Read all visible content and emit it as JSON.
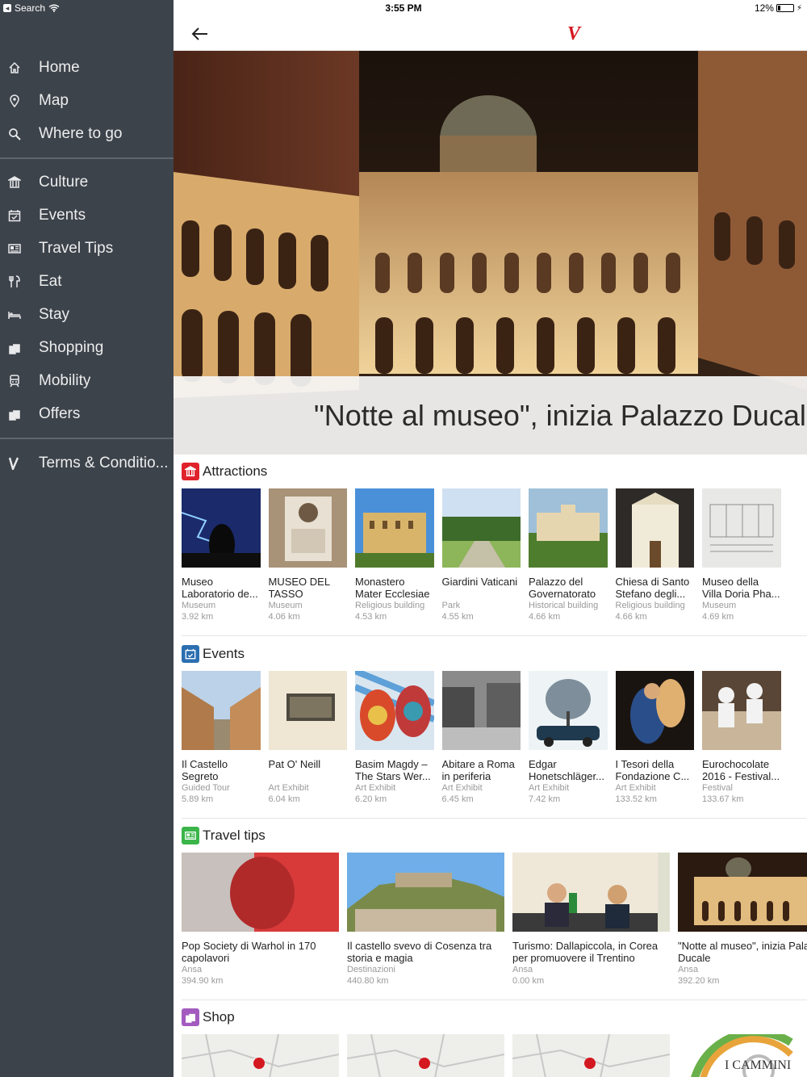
{
  "status_bar": {
    "back_label": "Search",
    "time": "3:55 PM",
    "battery": "12%"
  },
  "sidebar": {
    "main": [
      {
        "label": "Home",
        "icon": "home-icon"
      },
      {
        "label": "Map",
        "icon": "map-pin-icon"
      },
      {
        "label": "Where to go",
        "icon": "search-icon"
      }
    ],
    "categories": [
      {
        "label": "Culture",
        "icon": "museum-icon"
      },
      {
        "label": "Events",
        "icon": "calendar-icon"
      },
      {
        "label": "Travel Tips",
        "icon": "newspaper-icon"
      },
      {
        "label": "Eat",
        "icon": "restaurant-icon"
      },
      {
        "label": "Stay",
        "icon": "bed-icon"
      },
      {
        "label": "Shopping",
        "icon": "shopping-bag-icon"
      },
      {
        "label": "Mobility",
        "icon": "train-icon"
      },
      {
        "label": "Offers",
        "icon": "offers-bag-icon"
      }
    ],
    "footer": [
      {
        "label": "Terms & Conditio...",
        "icon": "brand-v-icon"
      }
    ]
  },
  "header": {
    "logo": "V"
  },
  "hero": {
    "caption": "\"Notte al museo\", inizia Palazzo Ducale"
  },
  "sections": {
    "attractions": {
      "title": "Attractions",
      "color": "#e0232b",
      "items": [
        {
          "title": "Museo Laboratorio de...",
          "category": "Museum",
          "distance": "3.92 km"
        },
        {
          "title": "MUSEO DEL TASSO",
          "category": "Museum",
          "distance": "4.06 km"
        },
        {
          "title": "Monastero Mater Ecclesiae",
          "category": "Religious building",
          "distance": "4.53 km"
        },
        {
          "title": "Giardini Vaticani",
          "category": "Park",
          "distance": "4.55 km"
        },
        {
          "title": "Palazzo del Governatorato",
          "category": "Historical building",
          "distance": "4.66 km"
        },
        {
          "title": "Chiesa di Santo Stefano degli...",
          "category": "Religious building",
          "distance": "4.66 km"
        },
        {
          "title": "Museo della Villa Doria Pha...",
          "category": "Museum",
          "distance": "4.69 km"
        }
      ]
    },
    "events": {
      "title": "Events",
      "color": "#2c6fb0",
      "items": [
        {
          "title": "Il Castello Segreto",
          "category": "Guided Tour",
          "distance": "5.89 km"
        },
        {
          "title": "Pat O' Neill",
          "category": "Art Exhibit",
          "distance": "6.04 km"
        },
        {
          "title": "Basim Magdy – The Stars Wer...",
          "category": "Art Exhibit",
          "distance": "6.20 km"
        },
        {
          "title": "Abitare a Roma in periferia",
          "category": "Art Exhibit",
          "distance": "6.45 km"
        },
        {
          "title": "Edgar Honetschläger...",
          "category": "Art Exhibit",
          "distance": "7.42 km"
        },
        {
          "title": "I Tesori della Fondazione C...",
          "category": "Art Exhibit",
          "distance": "133.52 km"
        },
        {
          "title": "Eurochocolate 2016 - Festival...",
          "category": "Festival",
          "distance": "133.67 km"
        }
      ]
    },
    "travel_tips": {
      "title": "Travel tips",
      "color": "#3bb54a",
      "items": [
        {
          "title": "Pop Society di Warhol in 170 capolavori",
          "category": "Ansa",
          "distance": "394.90 km"
        },
        {
          "title": "Il castello svevo di Cosenza tra storia e magia",
          "category": "Destinazioni",
          "distance": "440.80 km"
        },
        {
          "title": "Turismo: Dallapiccola, in Corea per promuovere il Trentino",
          "category": "Ansa",
          "distance": "0.00 km"
        },
        {
          "title": "\"Notte al museo\", inizia Palazzo Ducale",
          "category": "Ansa",
          "distance": "392.20 km"
        }
      ]
    },
    "shop": {
      "title": "Shop",
      "color": "#a35bbf",
      "items": [
        {
          "title": ""
        },
        {
          "title": ""
        },
        {
          "title": ""
        },
        {
          "title": "I CAMMINI"
        }
      ]
    }
  }
}
